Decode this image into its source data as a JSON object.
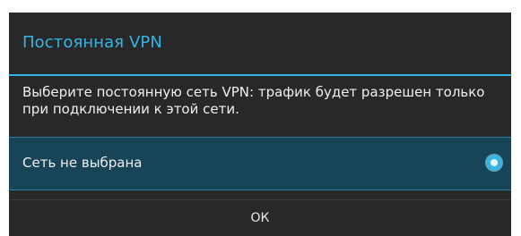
{
  "dialog": {
    "title": "Постоянная VPN",
    "message": "Выберите постоянную сеть VPN: трафик будет разрешен только при подключении к этой сети.",
    "options": [
      {
        "label": "Сеть не выбрана",
        "selected": true
      }
    ],
    "ok_label": "ОК"
  },
  "colors": {
    "accent": "#33b5e5",
    "dialog_background": "#282828",
    "selected_row_background": "#174456"
  }
}
